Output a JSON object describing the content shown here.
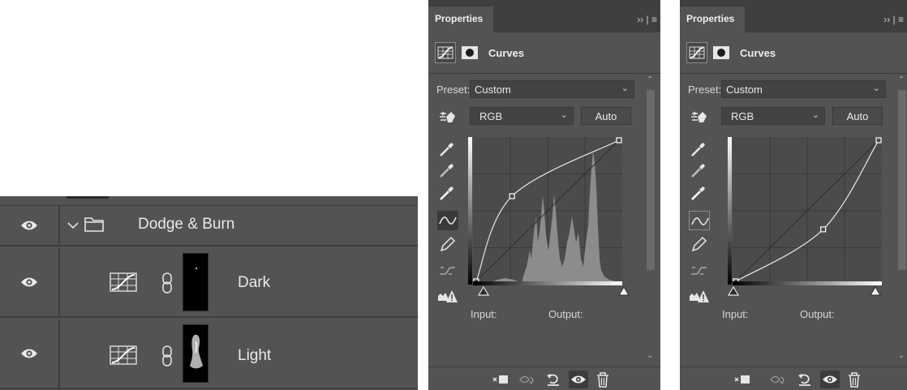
{
  "layers_panel": {
    "group": {
      "name": "Dodge & Burn"
    },
    "layers": [
      {
        "name": "Dark"
      },
      {
        "name": "Light"
      }
    ]
  },
  "properties_panels": [
    {
      "tab": "Properties",
      "tab_controls": "›› | ≡",
      "title": "Curves",
      "preset_label": "Preset:",
      "preset_value": "Custom",
      "channel_value": "RGB",
      "auto_label": "Auto",
      "input_label": "Input:",
      "output_label": "Output:",
      "curve_points": [
        [
          0,
          0
        ],
        [
          64,
          154
        ],
        [
          255,
          255
        ]
      ],
      "show_histogram": true
    },
    {
      "tab": "Properties",
      "tab_controls": "›› | ≡",
      "title": "Curves",
      "preset_label": "Preset:",
      "preset_value": "Custom",
      "channel_value": "RGB",
      "auto_label": "Auto",
      "input_label": "Input:",
      "output_label": "Output:",
      "curve_points": [
        [
          0,
          0
        ],
        [
          156,
          94
        ],
        [
          255,
          255
        ]
      ],
      "show_histogram": false
    }
  ],
  "icons": {
    "eye": "eye-icon",
    "folder": "folder-icon",
    "chevron": "chevron-down-icon",
    "curves_adjustment": "curves-adjustment-icon",
    "link": "link-icon",
    "mask": "mask-icon",
    "targeted_adjustment": "targeted-adjustment-icon",
    "eyedropper_black": "black-point-eyedropper-icon",
    "eyedropper_gray": "gray-point-eyedropper-icon",
    "eyedropper_white": "white-point-eyedropper-icon",
    "curve_edit": "edit-points-curve-icon",
    "pencil": "draw-pencil-icon",
    "smooth": "smooth-curve-icon",
    "clipping_warning": "clipping-warning-icon",
    "clip_to_layer": "clip-to-layer-icon",
    "view_previous": "view-previous-state-icon",
    "reset": "reset-icon",
    "visibility": "toggle-visibility-icon",
    "delete": "trash-icon"
  },
  "colors": {
    "panel_bg": "#535353",
    "tab_bar_bg": "#3f3f3f",
    "graph_bg": "#4b4b4b",
    "histogram": "#8f8f8f",
    "curve": "#e6e6e6"
  }
}
